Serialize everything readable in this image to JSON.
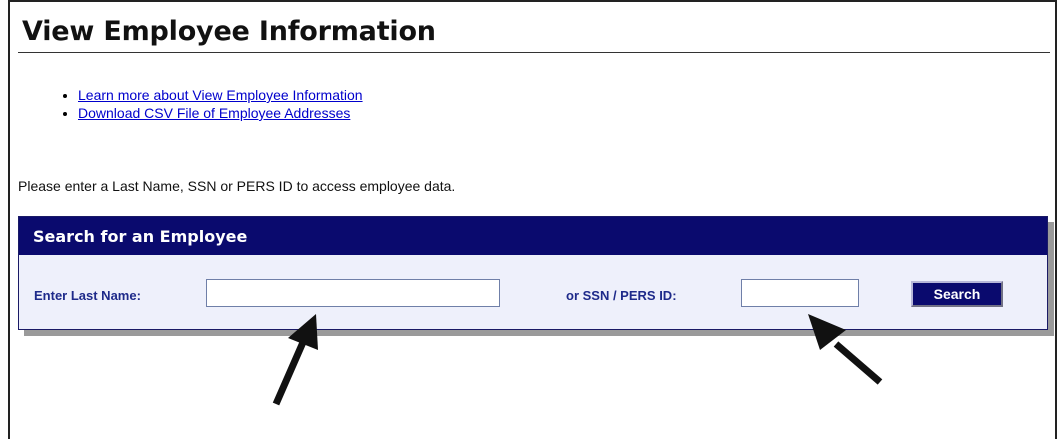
{
  "page": {
    "title": "View Employee Information",
    "links": [
      {
        "label": "Learn more about View Employee Information"
      },
      {
        "label": "Download CSV File of Employee Addresses"
      }
    ],
    "instruction": "Please enter a Last Name, SSN or PERS ID to access employee data."
  },
  "search_panel": {
    "header": "Search for an Employee",
    "last_name_label": "Enter Last Name:",
    "last_name_value": "",
    "ssn_label": "or SSN / PERS ID:",
    "ssn_value": "",
    "search_button": "Search"
  },
  "colors": {
    "panel_header_bg": "#0a0a6e",
    "panel_bg": "#eef0fb",
    "label_color": "#1e2a8a",
    "link_color": "#0000cc"
  }
}
